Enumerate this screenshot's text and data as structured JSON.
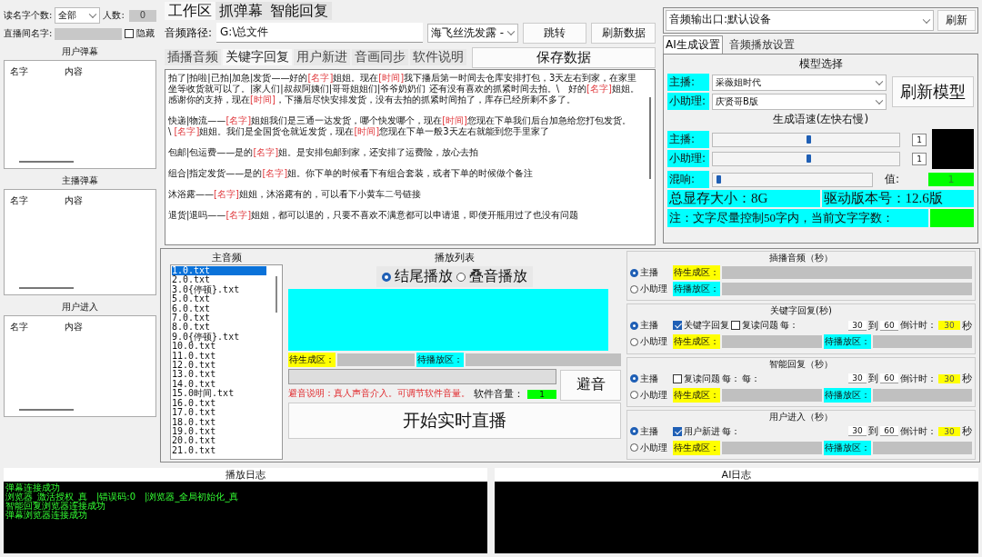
{
  "left": {
    "name_count_label": "读名字个数:",
    "name_count_value": "全部",
    "people_label": "人数:",
    "people_value": "0",
    "room_label": "直播间名字:",
    "hide": {
      "label": "隐藏",
      "checked": false
    },
    "lists": [
      {
        "title": "用户弹幕",
        "columns": [
          "名字",
          "内容"
        ]
      },
      {
        "title": "主播弹幕",
        "columns": [
          "名字",
          "内容"
        ]
      },
      {
        "title": "用户进入",
        "columns": [
          "名字",
          "内容"
        ]
      }
    ]
  },
  "tabs": [
    {
      "label": "工作区",
      "selected": true
    },
    {
      "label": "抓弹幕",
      "selected": false
    },
    {
      "label": "智能回复",
      "selected": false
    }
  ],
  "path": {
    "label": "音频路径:",
    "value": "G:\\总文件",
    "product": "海飞丝洗发露 -",
    "buttons": [
      "跳转",
      "刷新数据"
    ]
  },
  "subtabs": [
    {
      "label": "插播音频",
      "selected": false
    },
    {
      "label": "关键字回复",
      "selected": true
    },
    {
      "label": "用户新进",
      "selected": false
    },
    {
      "label": "音画同步",
      "selected": false
    },
    {
      "label": "软件说明",
      "selected": false
    }
  ],
  "save_button": "保存数据",
  "script": [
    [
      "拍了|拍啦|已拍|加急|发货——好的",
      "[名字]",
      "姐姐。现在",
      "[时间]",
      "我下播后第一时间去仓库安排打包，3天左右到家，在家里坐等收货就可以了。|家人们|叔叔阿姨们|哥哥姐姐们|爷爷奶奶们 还有没有喜欢的抓紧时间去拍。\\　好的",
      "[名字]",
      "姐姐。感谢你的支持，现在",
      "[时间]",
      "，下播后尽快安排发货，没有去拍的抓紧时间拍了，库存已经所剩不多了。"
    ],
    [
      "快递|物流——",
      "[名字]",
      "姐姐我们是三通一达发货，哪个快发哪个，现在",
      "[时间]",
      "您现在下单我们后台加急给您打包发货。　\\ ",
      "[名字]",
      "姐姐。我们是全国货仓就近发货，现在",
      "[时间]",
      "您现在下单一般3天左右就能到您手里家了"
    ],
    [
      "包邮|包运费——是的",
      "[名字]",
      "姐。是安排包邮到家，还安排了运费险，放心去拍"
    ],
    [
      "组合|指定发货——是的",
      "[名字]",
      "姐。你下单的时候看下有组合套装，或者下单的时候做个备注"
    ],
    [
      "沐浴露——",
      "[名字]",
      "姐姐，沐浴露有的，可以看下小黄车二号链接"
    ],
    [
      "退货|退吗——",
      "[名字]",
      "姐姐，都可以退的，只要不喜欢不满意都可以申请退，即便开瓶用过了也没有问题"
    ]
  ],
  "output": {
    "label": "音频输出口:",
    "value": "默认设备",
    "button": "刷新"
  },
  "right_tabs": [
    {
      "label": "AI生成设置",
      "selected": true
    },
    {
      "label": "音频播放设置",
      "selected": false
    }
  ],
  "model": {
    "title": "模型选择",
    "rows": [
      {
        "label": "主播:",
        "value": "采薇姐时代"
      },
      {
        "label": "小助理:",
        "value": "庆贤哥B版"
      }
    ],
    "button": "刷新模型"
  },
  "speed": {
    "title": "生成语速(左快右慢)",
    "rows": [
      {
        "label": "主播:",
        "level": 0.5,
        "value": "1"
      },
      {
        "label": "小助理:",
        "level": 0.5,
        "value": "1"
      }
    ]
  },
  "reverb": {
    "label": "混响:",
    "level": 0.02,
    "value_label": "值:",
    "value": "1"
  },
  "vram": "总显存大小：8G",
  "driver": "驱动版本号：12.6版",
  "note": "注：文字尽量控制50字内，当前文字字数：",
  "audio_list": {
    "title": "主音频",
    "items": [
      {
        "label": "1.0.txt",
        "selected": true
      },
      {
        "label": "2.0.txt",
        "selected": false
      },
      {
        "label": "3.0{停顿}.txt",
        "selected": false
      },
      {
        "label": "5.0.txt",
        "selected": false
      },
      {
        "label": "6.0.txt",
        "selected": false
      },
      {
        "label": "7.0.txt",
        "selected": false
      },
      {
        "label": "8.0.txt",
        "selected": false
      },
      {
        "label": "9.0{停顿}.txt",
        "selected": false
      },
      {
        "label": "10.0.txt",
        "selected": false
      },
      {
        "label": "11.0.txt",
        "selected": false
      },
      {
        "label": "12.0.txt",
        "selected": false
      },
      {
        "label": "13.0.txt",
        "selected": false
      },
      {
        "label": "14.0.txt",
        "selected": false
      },
      {
        "label": "15.0时间.txt",
        "selected": false
      },
      {
        "label": "16.0.txt",
        "selected": false
      },
      {
        "label": "17.0.txt",
        "selected": false
      },
      {
        "label": "18.0.txt",
        "selected": false
      },
      {
        "label": "19.0.txt",
        "selected": false
      },
      {
        "label": "20.0.txt",
        "selected": false
      },
      {
        "label": "21.0.txt",
        "selected": false
      }
    ]
  },
  "playlist": {
    "title": "播放列表",
    "modes": [
      {
        "label": "结尾播放",
        "selected": true
      },
      {
        "label": "叠音播放",
        "selected": false
      }
    ],
    "progress": {
      "level": 0
    },
    "pending_gen": "待生成区：",
    "pending_play": "待播放区：",
    "note": "避音说明：真人声音介入。可调节软件音量。",
    "volume_label": "软件音量：",
    "volume": "1",
    "duck_button": "避音",
    "start_button": "开始实时直播"
  },
  "groups": [
    {
      "kind": "simple",
      "title": "插播音频（秒）",
      "radios": [
        {
          "label": "主播",
          "selected": true
        },
        {
          "label": "小助理",
          "selected": false
        }
      ],
      "zones": [
        "待生成区：",
        "待播放区："
      ]
    },
    {
      "kind": "timed",
      "title": "关键字回复(秒)",
      "radios": [
        {
          "label": "主播",
          "selected": true
        },
        {
          "label": "小助理",
          "selected": false
        }
      ],
      "checks": [
        {
          "label": "关键字回复",
          "checked": true
        },
        {
          "label": "复读问题",
          "checked": false
        }
      ],
      "every": [
        "每："
      ],
      "from": "30",
      "to_label": "到",
      "to": "60",
      "countdown_label": "倒计时：",
      "countdown": "30",
      "unit": "秒",
      "zones": [
        "待生成区：",
        "待播放区："
      ]
    },
    {
      "kind": "timed",
      "title": "智能回复（秒）",
      "radios": [
        {
          "label": "主播",
          "selected": true
        },
        {
          "label": "小助理",
          "selected": false
        }
      ],
      "checks": [
        {
          "label": "复读问题",
          "checked": false
        }
      ],
      "every": [
        "每：",
        "每："
      ],
      "from": "30",
      "to_label": "到",
      "to": "60",
      "countdown_label": "倒计时：",
      "countdown": "30",
      "unit": "秒",
      "zones": [
        "待生成区：",
        "待播放区："
      ]
    },
    {
      "kind": "timed",
      "title": "用户进入（秒）",
      "radios": [
        {
          "label": "主播",
          "selected": true
        },
        {
          "label": "小助理",
          "selected": false
        }
      ],
      "checks": [
        {
          "label": "用户新进",
          "checked": true
        }
      ],
      "every": [
        "每："
      ],
      "from": "30",
      "to_label": "到",
      "to": "60",
      "countdown_label": "倒计时：",
      "countdown": "30",
      "unit": "秒",
      "zones": [
        "待生成区：",
        "待播放区："
      ]
    }
  ],
  "play_log": {
    "title": "播放日志",
    "lines": [
      "弹幕连接成功",
      "浏览器_激活授权_真　|错误码:0　|浏览器_全局初始化_真",
      "智能回复浏览器连接成功",
      "弹幕浏览器连接成功"
    ]
  },
  "ai_log": {
    "title": "AI日志"
  }
}
